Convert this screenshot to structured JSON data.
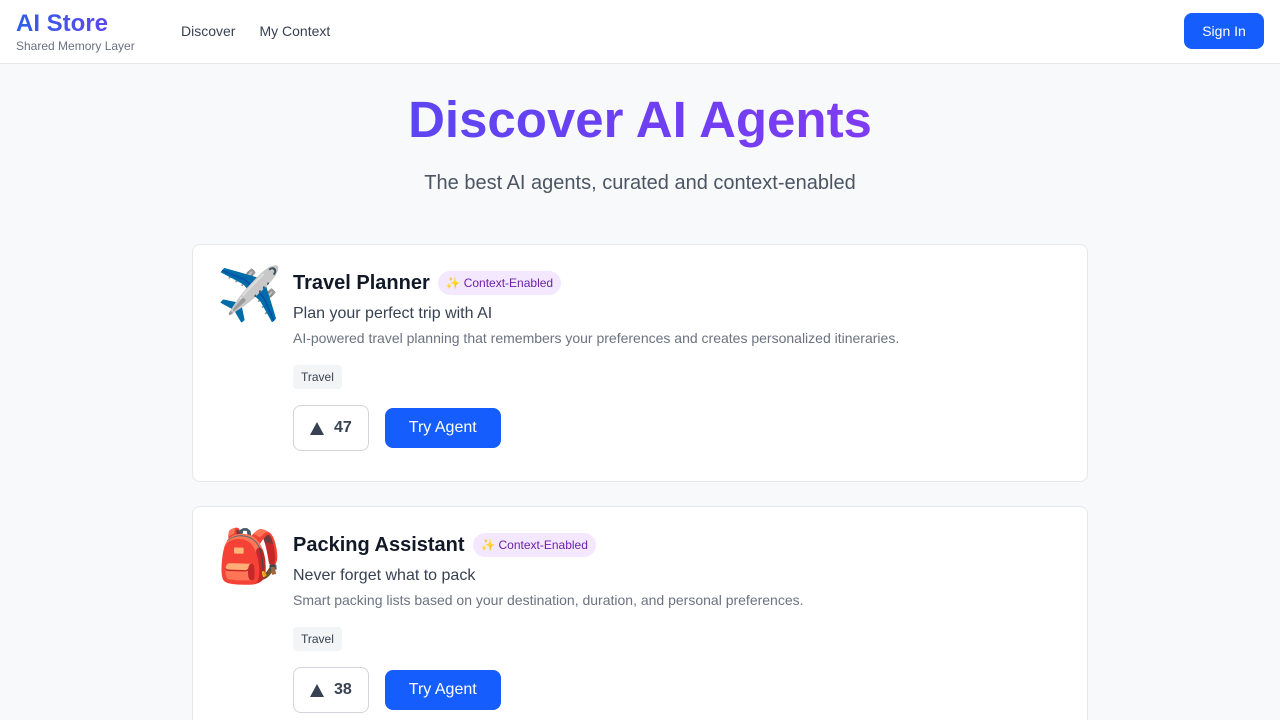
{
  "brand": {
    "name": "AI Store",
    "subtitle": "Shared Memory Layer"
  },
  "nav": [
    {
      "label": "Discover"
    },
    {
      "label": "My Context"
    }
  ],
  "auth": {
    "sign_in_label": "Sign In"
  },
  "colors": {
    "primary": "#155dfc",
    "badge_bg": "#f3e8ff",
    "badge_text": "#6b21a8",
    "brand_gradient_start": "#2f5fe8",
    "brand_gradient_end": "#6b3ff0"
  },
  "hero": {
    "title": "Discover AI Agents",
    "subtitle": "The best AI agents, curated and context-enabled"
  },
  "agents": [
    {
      "icon": "✈️",
      "icon_name": "airplane-icon",
      "name": "Travel Planner",
      "badge_icon": "✨",
      "badge_label": "Context-Enabled",
      "tagline": "Plan your perfect trip with AI",
      "description": "AI-powered travel planning that remembers your preferences and creates personalized itineraries.",
      "category": "Travel",
      "upvotes": "47",
      "cta_label": "Try Agent"
    },
    {
      "icon": "🎒",
      "icon_name": "backpack-icon",
      "name": "Packing Assistant",
      "badge_icon": "✨",
      "badge_label": "Context-Enabled",
      "tagline": "Never forget what to pack",
      "description": "Smart packing lists based on your destination, duration, and personal preferences.",
      "category": "Travel",
      "upvotes": "38",
      "cta_label": "Try Agent"
    }
  ]
}
